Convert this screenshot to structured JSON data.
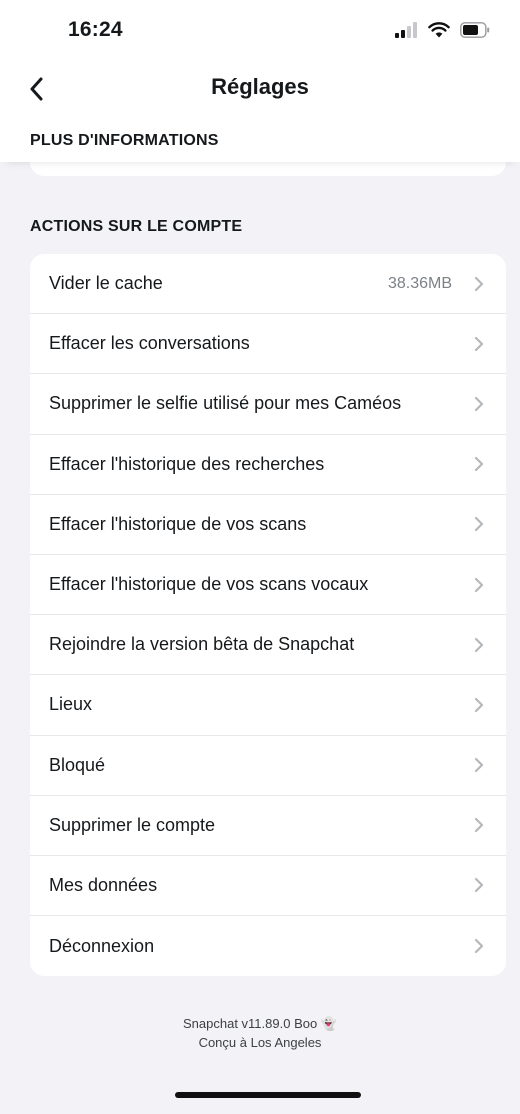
{
  "status": {
    "time": "16:24"
  },
  "nav": {
    "title": "Réglages"
  },
  "section_top": {
    "title": "PLUS D'INFORMATIONS"
  },
  "section": {
    "title": "ACTIONS SUR LE COMPTE"
  },
  "rows": [
    {
      "label": "Vider le cache",
      "value": "38.36MB"
    },
    {
      "label": "Effacer les conversations"
    },
    {
      "label": "Supprimer le selfie utilisé pour mes Caméos"
    },
    {
      "label": "Effacer l'historique des recherches"
    },
    {
      "label": "Effacer l'historique de vos scans"
    },
    {
      "label": "Effacer l'historique de vos scans vocaux"
    },
    {
      "label": "Rejoindre la version bêta de Snapchat"
    },
    {
      "label": "Lieux"
    },
    {
      "label": "Bloqué"
    },
    {
      "label": "Supprimer le compte"
    },
    {
      "label": "Mes données"
    },
    {
      "label": "Déconnexion"
    }
  ],
  "footer": {
    "version": "Snapchat v11.89.0 Boo 👻",
    "made_in": "Conçu à Los Angeles"
  },
  "icons": {
    "back": "chevron-left-icon",
    "row_chevron": "chevron-right-icon"
  },
  "colors": {
    "background": "#f2f2f7",
    "card": "#ffffff",
    "chevron": "#b5b8bc"
  }
}
